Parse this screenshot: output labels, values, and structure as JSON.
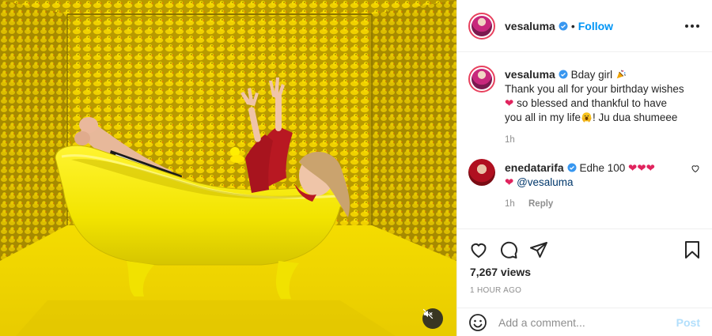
{
  "post": {
    "author": "vesaluma",
    "follow_label": "Follow",
    "separator": "•",
    "caption_parts": {
      "line1": "Bday girl",
      "line2": "Thank you all for your birthday wishes",
      "line3": "so blessed and thankful to have",
      "line4": "you all in my life",
      "line5": "! Ju dua shumeee"
    },
    "caption_emojis": [
      "party-popper",
      "red-heart",
      "face-with-hands"
    ],
    "caption_age": "1h",
    "views": "7,267 views",
    "timestamp": "1 HOUR AGO"
  },
  "comments": [
    {
      "author": "enedatarifa",
      "text_start": "Edhe 100",
      "hearts": "❤❤❤",
      "heart": "❤",
      "mention": "@vesaluma",
      "age": "1h",
      "reply_label": "Reply"
    }
  ],
  "composer": {
    "placeholder": "Add a comment...",
    "post_label": "Post"
  },
  "colors": {
    "link": "#0095f6",
    "heart": "#e0245e",
    "story_ring": "#e8415e",
    "wall_yellow": "#e2c200",
    "tub_yellow": "#f3ea00"
  }
}
